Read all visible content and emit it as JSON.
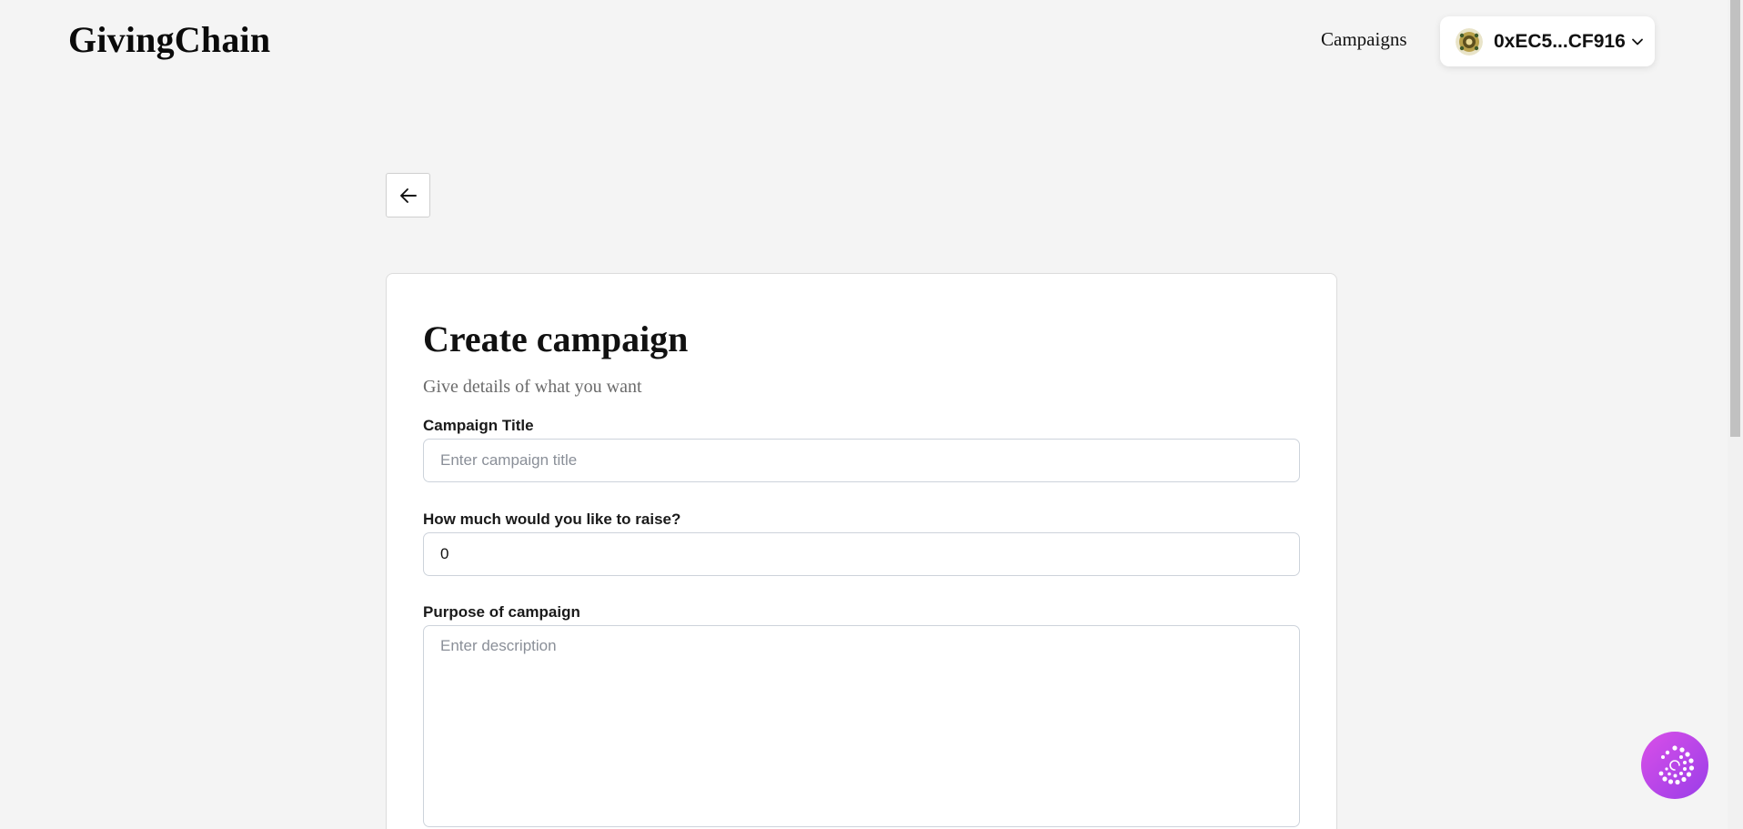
{
  "header": {
    "logo": "GivingChain",
    "nav_campaigns": "Campaigns",
    "wallet_address": "0xEC5...CF916"
  },
  "form": {
    "title": "Create campaign",
    "subtitle": "Give details of what you want",
    "campaign_title_label": "Campaign Title",
    "campaign_title_placeholder": "Enter campaign title",
    "campaign_title_value": "",
    "raise_label": "How much would you like to raise?",
    "raise_value": "0",
    "purpose_label": "Purpose of campaign",
    "purpose_placeholder": "Enter description",
    "purpose_value": ""
  },
  "colors": {
    "background": "#f4f4f4",
    "card": "#ffffff",
    "fab_gradient_start": "#d94fe8",
    "fab_gradient_end": "#9a3ee8"
  },
  "icons": {
    "back": "arrow-left-icon",
    "wallet_avatar": "wallet-avatar-icon",
    "wallet_dropdown": "chevron-down-icon",
    "assistant": "spiral-dots-icon"
  }
}
